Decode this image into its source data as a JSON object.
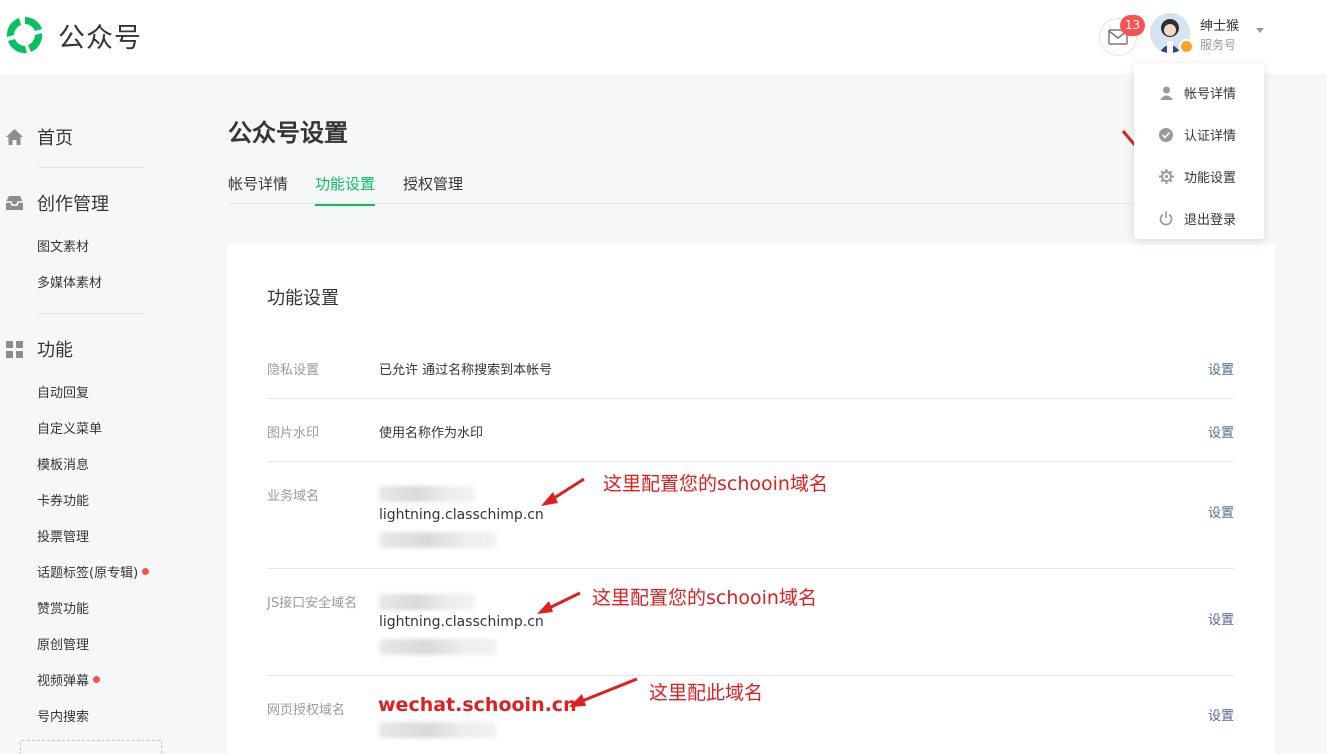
{
  "brand": {
    "name": "公众号"
  },
  "header": {
    "mail_count": "13",
    "user_name": "绅士猴",
    "account_type": "服务号"
  },
  "user_menu": {
    "items": [
      {
        "label": "帐号详情",
        "icon": "user-icon"
      },
      {
        "label": "认证详情",
        "icon": "verified-icon"
      },
      {
        "label": "功能设置",
        "icon": "gear-icon"
      },
      {
        "label": "退出登录",
        "icon": "power-icon"
      }
    ]
  },
  "sidebar": {
    "home": "首页",
    "creation": {
      "title": "创作管理",
      "items": [
        "图文素材",
        "多媒体素材"
      ]
    },
    "features": {
      "title": "功能",
      "items": [
        {
          "label": "自动回复",
          "dot": false
        },
        {
          "label": "自定义菜单",
          "dot": false
        },
        {
          "label": "模板消息",
          "dot": false
        },
        {
          "label": "卡券功能",
          "dot": false
        },
        {
          "label": "投票管理",
          "dot": false
        },
        {
          "label": "话题标签(原专辑)",
          "dot": true
        },
        {
          "label": "赞赏功能",
          "dot": false
        },
        {
          "label": "原创管理",
          "dot": false
        },
        {
          "label": "视频弹幕",
          "dot": true
        },
        {
          "label": "号内搜索",
          "dot": false
        }
      ]
    }
  },
  "page": {
    "title": "公众号设置",
    "tabs": [
      {
        "label": "帐号详情",
        "active": false
      },
      {
        "label": "功能设置",
        "active": true
      },
      {
        "label": "授权管理",
        "active": false
      }
    ]
  },
  "settings": {
    "title": "功能设置",
    "set_label": "设置",
    "rows": [
      {
        "label": "隐私设置",
        "value": "已允许 通过名称搜索到本帐号"
      },
      {
        "label": "图片水印",
        "value": "使用名称作为水印"
      },
      {
        "label": "业务域名",
        "domain": "lightning.classchimp.cn"
      },
      {
        "label": "JS接口安全域名",
        "domain": "lightning.classchimp.cn"
      },
      {
        "label": "网页授权域名",
        "domain": "wechat.schooin.cn"
      }
    ]
  },
  "annotations": {
    "business_domain": "这里配置您的schooin域名",
    "js_domain": "这里配置您的schooin域名",
    "oauth_domain": "这里配此域名"
  },
  "colors": {
    "accent": "#07c160",
    "link": "#576b95",
    "annotation": "#e02020",
    "badge": "#fa5151"
  }
}
